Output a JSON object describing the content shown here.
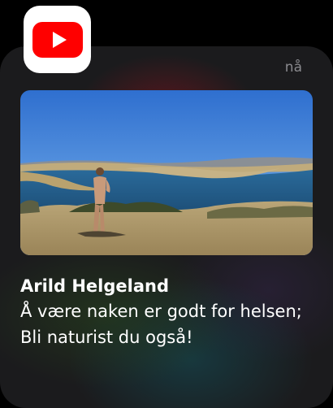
{
  "notification": {
    "app_icon": "youtube-icon",
    "time": "nå",
    "sender": "Arild Helgeland",
    "message": "Å være naken er godt for helsen; Bli naturist du også!"
  },
  "colors": {
    "background": "#000000",
    "card": "#1b1b1d",
    "brand_red": "#ff0000",
    "time_text": "#8a8a8e",
    "text": "#ffffff"
  }
}
